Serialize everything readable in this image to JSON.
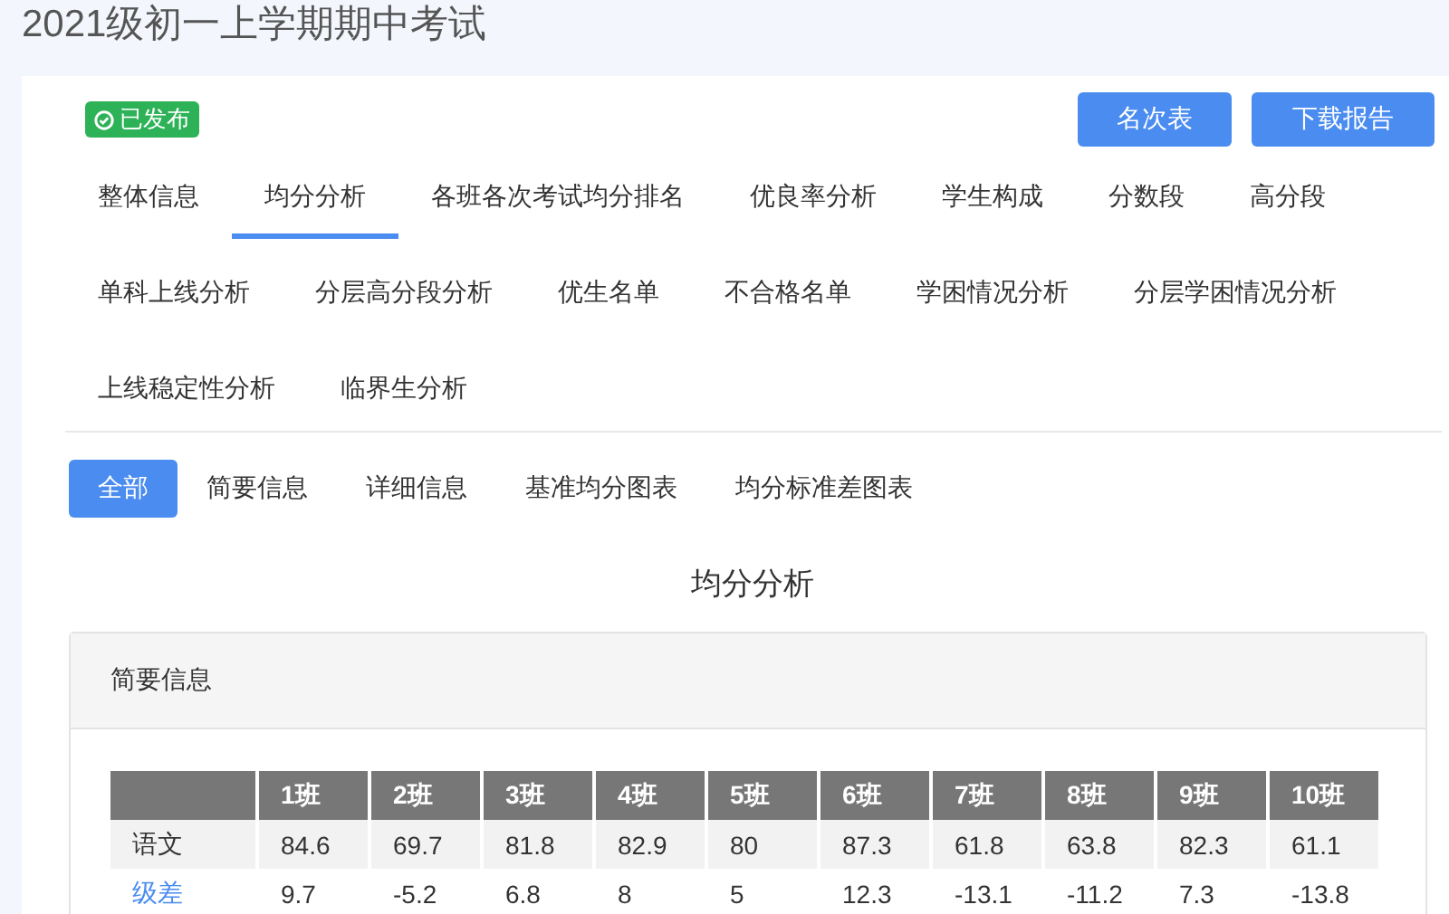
{
  "title": "2021级初一上学期期中考试",
  "status_badge": "已发布",
  "buttons": [
    "名次表",
    "下载报告"
  ],
  "tabs": [
    {
      "label": "整体信息",
      "selected": false
    },
    {
      "label": "均分分析",
      "selected": true
    },
    {
      "label": "各班各次考试均分排名",
      "selected": false
    },
    {
      "label": "优良率分析",
      "selected": false
    },
    {
      "label": "学生构成",
      "selected": false
    },
    {
      "label": "分数段",
      "selected": false
    },
    {
      "label": "高分段",
      "selected": false
    },
    {
      "label": "单科上线分析",
      "selected": false
    },
    {
      "label": "分层高分段分析",
      "selected": false
    },
    {
      "label": "优生名单",
      "selected": false
    },
    {
      "label": "不合格名单",
      "selected": false
    },
    {
      "label": "学困情况分析",
      "selected": false
    },
    {
      "label": "分层学困情况分析",
      "selected": false
    },
    {
      "label": "上线稳定性分析",
      "selected": false
    },
    {
      "label": "临界生分析",
      "selected": false
    }
  ],
  "sub_tabs": [
    {
      "label": "全部",
      "selected": true
    },
    {
      "label": "简要信息",
      "selected": false
    },
    {
      "label": "详细信息",
      "selected": false
    },
    {
      "label": "基准均分图表",
      "selected": false
    },
    {
      "label": "均分标准差图表",
      "selected": false
    }
  ],
  "section_title": "均分分析",
  "panel": {
    "title": "简要信息",
    "table": {
      "columns": [
        "1班",
        "2班",
        "3班",
        "4班",
        "5班",
        "6班",
        "7班",
        "8班",
        "9班",
        "10班"
      ],
      "rows": [
        {
          "label": "语文",
          "kind": "plain",
          "cells": [
            "84.6",
            "69.7",
            "81.8",
            "82.9",
            "80",
            "87.3",
            "61.8",
            "63.8",
            "82.3",
            "61.1"
          ]
        },
        {
          "label": "级差",
          "kind": "link",
          "cells": [
            "9.7",
            "-5.2",
            "6.8",
            "8",
            "5",
            "12.3",
            "-13.1",
            "-11.2",
            "7.3",
            "-13.8"
          ]
        }
      ]
    }
  }
}
